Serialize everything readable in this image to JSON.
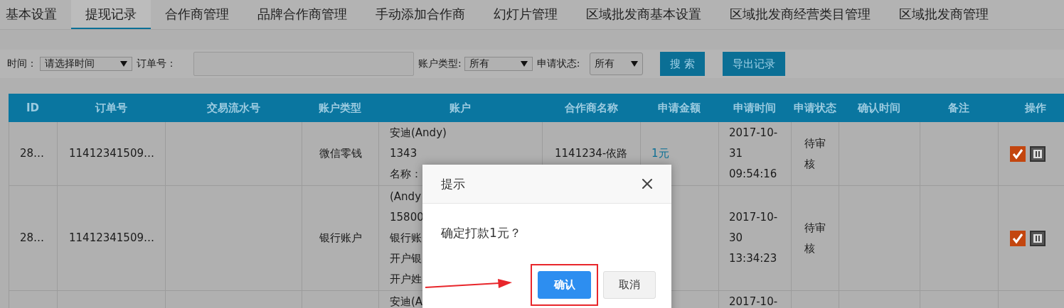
{
  "tabs": [
    {
      "label": "基本设置",
      "selected": false
    },
    {
      "label": "提现记录",
      "selected": true
    },
    {
      "label": "合作商管理",
      "selected": false
    },
    {
      "label": "品牌合作商管理",
      "selected": false
    },
    {
      "label": "手动添加合作商",
      "selected": false
    },
    {
      "label": "幻灯片管理",
      "selected": false
    },
    {
      "label": "区域批发商基本设置",
      "selected": false
    },
    {
      "label": "区域批发商经营类目管理",
      "selected": false
    },
    {
      "label": "区域批发商管理",
      "selected": false
    }
  ],
  "filters": {
    "time_label": "时间：",
    "time_select": "请选择时间",
    "order_label": "订单号：",
    "account_type_label": "账户类型:",
    "account_type_select": "所有",
    "status_label": "申请状态:",
    "status_select": "所有",
    "buttons": [
      "搜 索",
      "导出记录"
    ]
  },
  "table": {
    "columns": [
      "ID",
      "订单号",
      "交易流水号",
      "账户类型",
      "账户",
      "合作商名称",
      "申请金额",
      "申请时间",
      "申请状态",
      "确认时间",
      "备注",
      "操作"
    ],
    "rows": [
      {
        "id": "28…",
        "order_no": "11412341509…",
        "account_type": "微信零钱",
        "account": [
          "安迪(Andy)",
          "1343",
          "名称："
        ],
        "partner": [
          "1141234-依路"
        ],
        "amount": "1元",
        "apply_time": [
          "2017-10-",
          "31",
          "09:54:16"
        ],
        "status": [
          "待审",
          "核"
        ],
        "actions": true
      },
      {
        "id": "28…",
        "order_no": "11412341509…",
        "account_type": "银行账户",
        "account": [
          "(Andy",
          "15800",
          "银行账",
          "开户银",
          "开户姓"
        ],
        "partner": [],
        "amount": "",
        "apply_time": [
          "2017-10-",
          "30",
          "13:34:23"
        ],
        "status": [
          "待审",
          "核"
        ],
        "actions": true
      },
      {
        "id": "",
        "order_no": "",
        "account_type": "",
        "account": [
          "安迪(A"
        ],
        "partner": [],
        "amount": "",
        "apply_time": [
          "2017-10-"
        ],
        "status": [],
        "actions": false
      }
    ]
  },
  "dialog": {
    "title": "提示",
    "message": "确定打款1元？",
    "confirm": "确认",
    "cancel": "取消",
    "confirm_highlighted": true
  }
}
